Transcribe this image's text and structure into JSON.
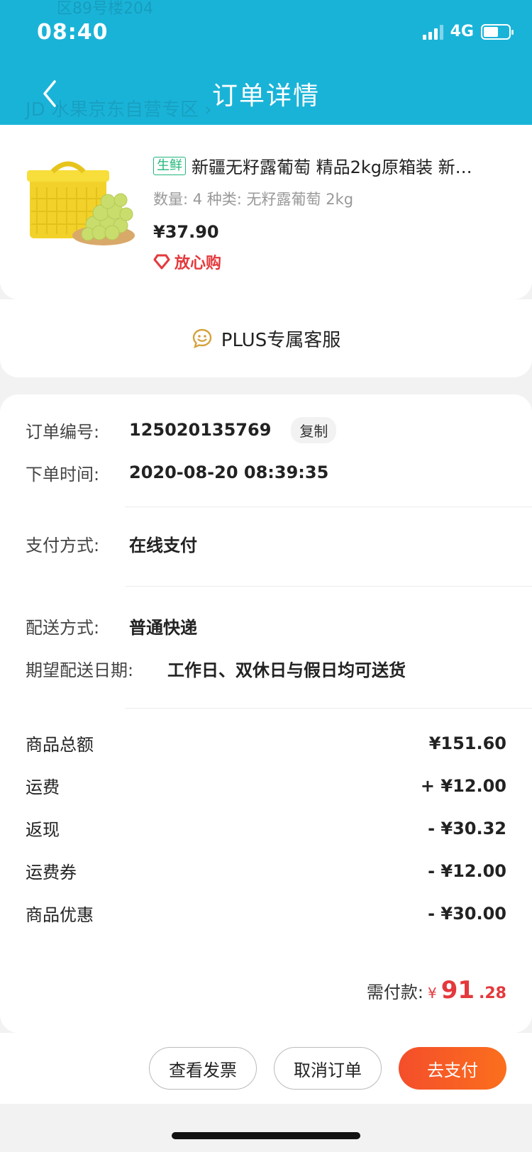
{
  "status_bar": {
    "time": "08:40",
    "network": "4G",
    "battery_level_pct": 60
  },
  "header": {
    "title": "订单详情",
    "ghost_address": "区89号楼204",
    "ghost_store": "JD 水果京东自营专区 ›"
  },
  "product": {
    "tag": "生鲜",
    "title": "新疆无籽露葡萄 精品2kg原箱装 新…",
    "spec": "数量: 4  种类: 无籽露葡萄 2kg",
    "price": "¥37.90",
    "badge": "放心购"
  },
  "service": {
    "label": "PLUS专属客服"
  },
  "order_info": {
    "order_no_label": "订单编号:",
    "order_no": "125020135769",
    "copy_label": "复制",
    "order_time_label": "下单时间:",
    "order_time": "2020-08-20 08:39:35",
    "payment_label": "支付方式:",
    "payment": "在线支付",
    "delivery_label": "配送方式:",
    "delivery": "普通快递",
    "expected_label": "期望配送日期:",
    "expected": "工作日、双休日与假日均可送货"
  },
  "fees": [
    {
      "label": "商品总额",
      "value": "¥151.60"
    },
    {
      "label": "运费",
      "value": "+ ¥12.00"
    },
    {
      "label": "返现",
      "value": "- ¥30.32"
    },
    {
      "label": "运费券",
      "value": "- ¥12.00"
    },
    {
      "label": "商品优惠",
      "value": "- ¥30.00"
    }
  ],
  "total": {
    "label": "需付款:",
    "symbol": "¥",
    "integer": "91",
    "decimal": ".28"
  },
  "actions": {
    "invoice": "查看发票",
    "cancel": "取消订单",
    "pay": "去支付"
  },
  "colors": {
    "header_bg": "#1ab3d8",
    "accent_red": "#e4393c",
    "pay_button": "#f44e2b",
    "fresh_green": "#1fb87a"
  }
}
